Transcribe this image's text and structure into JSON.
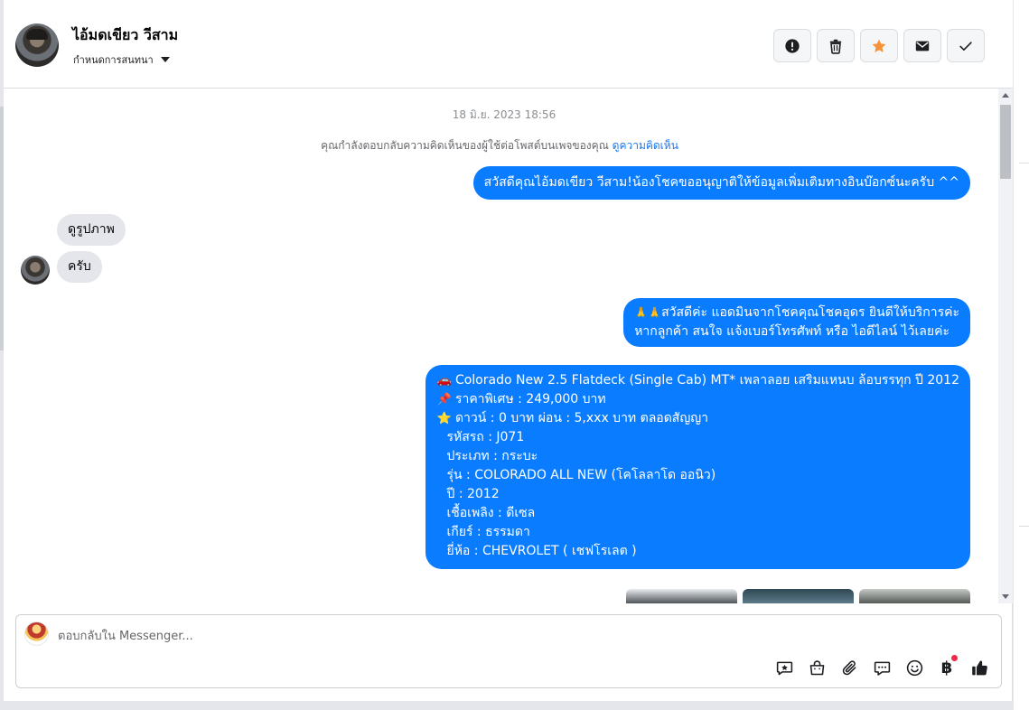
{
  "header": {
    "contact_name": "ไอ้มดเขียว วีสาม",
    "assign_label": "กำหนดการสนทนา",
    "actions": [
      {
        "name": "report-button",
        "icon": "alert-icon"
      },
      {
        "name": "delete-button",
        "icon": "trash-icon"
      },
      {
        "name": "star-button",
        "icon": "star-icon"
      },
      {
        "name": "mark-unread-button",
        "icon": "envelope-icon"
      },
      {
        "name": "mark-done-button",
        "icon": "check-icon"
      }
    ]
  },
  "thread": {
    "timestamp": "18 มิ.ย. 2023 18:56",
    "context_text": "คุณกำลังตอบกลับความคิดเห็นของผู้ใช้ต่อโพสต์บนเพจของคุณ",
    "context_link": "ดูความคิดเห็น",
    "msg_out_1": "สวัสดีคุณไอ้มดเขียว วีสาม!น้องโชคขออนุญาติให้ข้อมูลเพิ่มเติมทางอินบ๊อกซ์นะครับ ^^",
    "msg_in_1": "ดูรูปภาพ",
    "msg_in_2": "ครับ",
    "msg_out_2": {
      "emoji": "🙏🙏",
      "line1": "สวัสดีค่ะ แอดมินจากโชคคุณโชคอุดร ยินดีให้บริการค่ะ",
      "line2": "หากลูกค้า สนใจ แจ้งเบอร์โทรศัพท์ หรือ ไอดีไลน์  ไว้เลยค่ะ"
    },
    "msg_out_3": {
      "line1_emoji": "🚗",
      "line1": "Colorado New 2.5 Flatdeck (Single Cab) MT* เพลาลอย เสริมแหนบ ล้อบรรทุก  ปี 2012",
      "line2_emoji": "📌",
      "line2": "ราคาพิเศษ : 249,000 บาท",
      "line3_emoji": "⭐",
      "line3": "ดาวน์ : 0 บาท ผ่อน : 5,xxx บาท ตลอดสัญญา",
      "line4": "รหัสรถ : J071",
      "line5": "ประเภท : กระบะ",
      "line6": "รุ่น : COLORADO ALL NEW (โคโลลาโด ออนิว)",
      "line7": "ปี : 2012",
      "line8": "เชื้อเพลิง : ดีเซล",
      "line9": "เกียร์ : ธรรมดา",
      "line10": "ยี่ห้อ : CHEVROLET ( เชฟโรเลต )"
    }
  },
  "composer": {
    "placeholder": "ตอบกลับใน Messenger...",
    "icons": [
      "saved-reply-icon",
      "shop-icon",
      "attachment-icon",
      "chat-bubble-icon",
      "emoji-icon",
      "baht-icon",
      "thumbs-up-icon"
    ],
    "baht_symbol": "฿"
  },
  "colors": {
    "outgoing_bubble": "#0a7cff",
    "incoming_bubble": "#e4e6eb",
    "accent_star": "#f7923b",
    "thumbs_up": "#1c1e21"
  }
}
